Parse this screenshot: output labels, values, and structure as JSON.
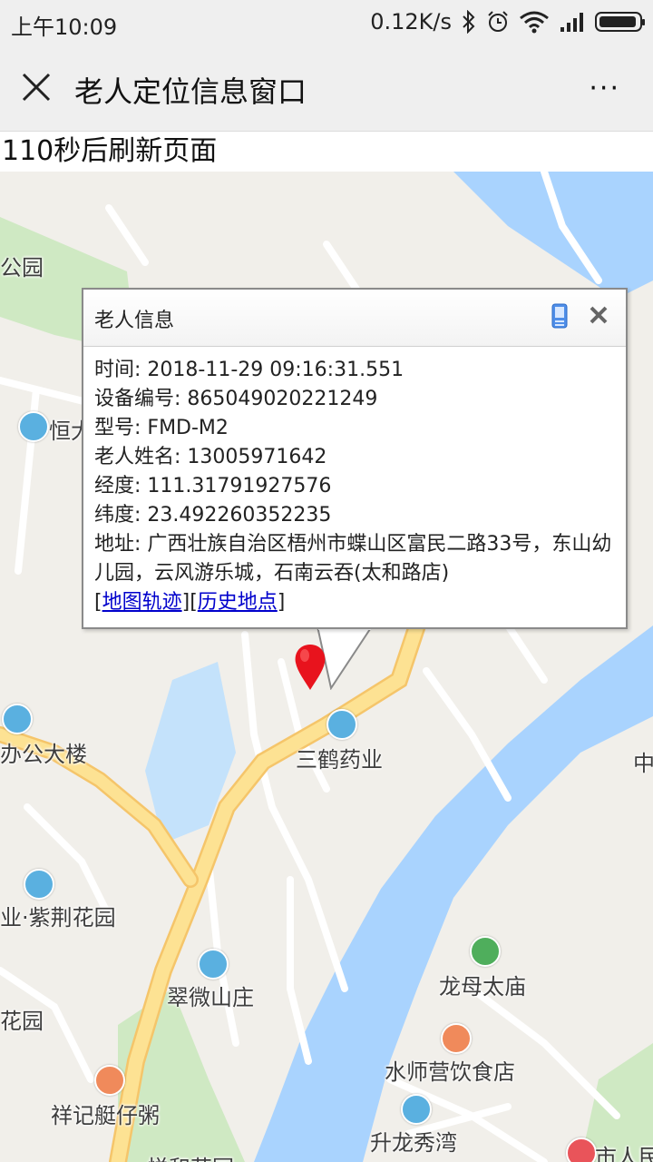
{
  "status": {
    "time": "上午10:09",
    "speed": "0.12K/s"
  },
  "header": {
    "title": "老人定位信息窗口",
    "more": "···"
  },
  "refresh_text": "110秒后刷新页面",
  "popup": {
    "title": "老人信息",
    "time_label": "时间",
    "time_value": "2018-11-29 09:16:31.551",
    "device_label": "设备编号",
    "device_value": "865049020221249",
    "model_label": "型号",
    "model_value": "FMD-M2",
    "name_label": "老人姓名",
    "name_value": "13005971642",
    "lng_label": "经度",
    "lng_value": "111.31791927576",
    "lat_label": "纬度",
    "lat_value": "23.492260352235",
    "address_label": "地址",
    "address_value": "广西壮族自治区梧州市蝶山区富民二路33号，东山幼儿园，云风游乐城，石南云吞(太和路店)",
    "link_track": "地图轨迹",
    "link_history": "历史地点"
  },
  "map": {
    "poi": {
      "park_top": "公园",
      "heng": "恒大",
      "office": "办公大楼",
      "sanhe": "三鹤药业",
      "zijing": "业·紫荆花园",
      "cuiwei": "翠微山庄",
      "longmu": "龙母太庙",
      "flower_garden": "花园",
      "shuishi": "水师营饮食店",
      "xiangji": "祥记艇仔粥",
      "shenglong": "升龙秀湾",
      "shiren": "市人民",
      "zhong": "中",
      "yuehe": "悦和花园"
    },
    "colors": {
      "water": "#a9d3fe",
      "green": "#cfe9c3",
      "road_major": "#fde293",
      "road_major_edge": "#f5c56a",
      "land": "#f1efea"
    }
  }
}
